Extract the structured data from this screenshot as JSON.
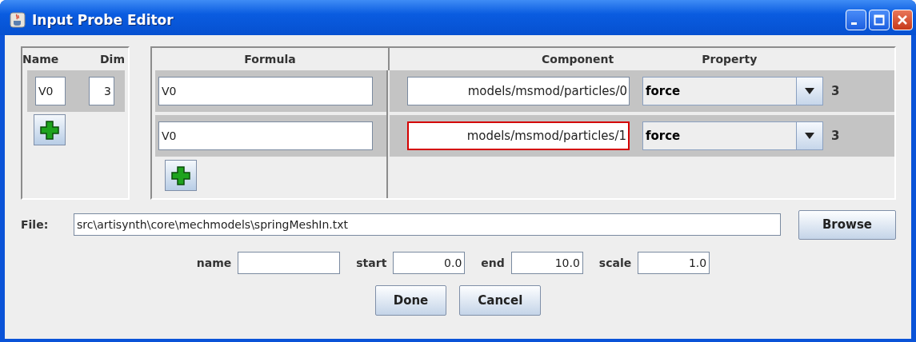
{
  "window": {
    "title": "Input Probe Editor"
  },
  "inputs": {
    "columns": [
      "Name",
      "Dim"
    ],
    "rows": [
      {
        "name": "V0",
        "dim": "3"
      }
    ]
  },
  "channels": {
    "columns": [
      "Formula",
      "Component",
      "Property"
    ],
    "rows": [
      {
        "formula": "V0",
        "component": "models/msmod/particles/0",
        "property": "force",
        "size": "3",
        "invalid": false
      },
      {
        "formula": "V0",
        "component": "models/msmod/particles/1",
        "property": "force",
        "size": "3",
        "invalid": true
      }
    ]
  },
  "file": {
    "label": "File:",
    "value": "src\\artisynth\\core\\mechmodels\\springMeshIn.txt",
    "button": "Browse"
  },
  "params": [
    {
      "label": "name"
    },
    {
      "label": "start",
      "value": "0.0"
    },
    {
      "label": "end",
      "value": "10.0"
    },
    {
      "label": "scale",
      "value": "1.0"
    }
  ],
  "buttons": [
    "Done",
    "Cancel"
  ]
}
